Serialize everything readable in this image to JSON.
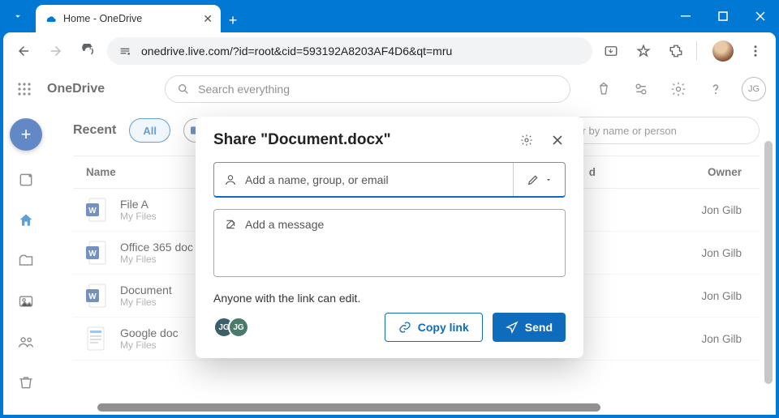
{
  "browser": {
    "tab_title": "Home - OneDrive",
    "url": "onedrive.live.com/?id=root&cid=593192A8203AF4D6&qt=mru"
  },
  "onedrive": {
    "brand": "OneDrive",
    "search_placeholder": "Search everything",
    "user_initials": "JG",
    "recent_label": "Recent",
    "pill_all": "All",
    "filter_placeholder": "Filter by name or person",
    "columns": {
      "name": "Name",
      "opened": "Opened",
      "owner": "Owner"
    },
    "files": [
      {
        "name": "File A",
        "location": "My Files",
        "opened": "",
        "owner": "Jon Gilb"
      },
      {
        "name": "Office 365 doc",
        "location": "My Files",
        "opened": "",
        "owner": "Jon Gilb"
      },
      {
        "name": "Document",
        "location": "My Files",
        "opened": "",
        "owner": "Jon Gilb"
      },
      {
        "name": "Google doc",
        "location": "My Files",
        "opened": "",
        "owner": "Jon Gilb"
      }
    ]
  },
  "modal": {
    "title": "Share \"Document.docx\"",
    "recipient_placeholder": "Add a name, group, or email",
    "message_placeholder": "Add a message",
    "link_info": "Anyone with the link can edit.",
    "avatar1": "JG",
    "avatar2": "JG",
    "copy_link_label": "Copy link",
    "send_label": "Send"
  }
}
